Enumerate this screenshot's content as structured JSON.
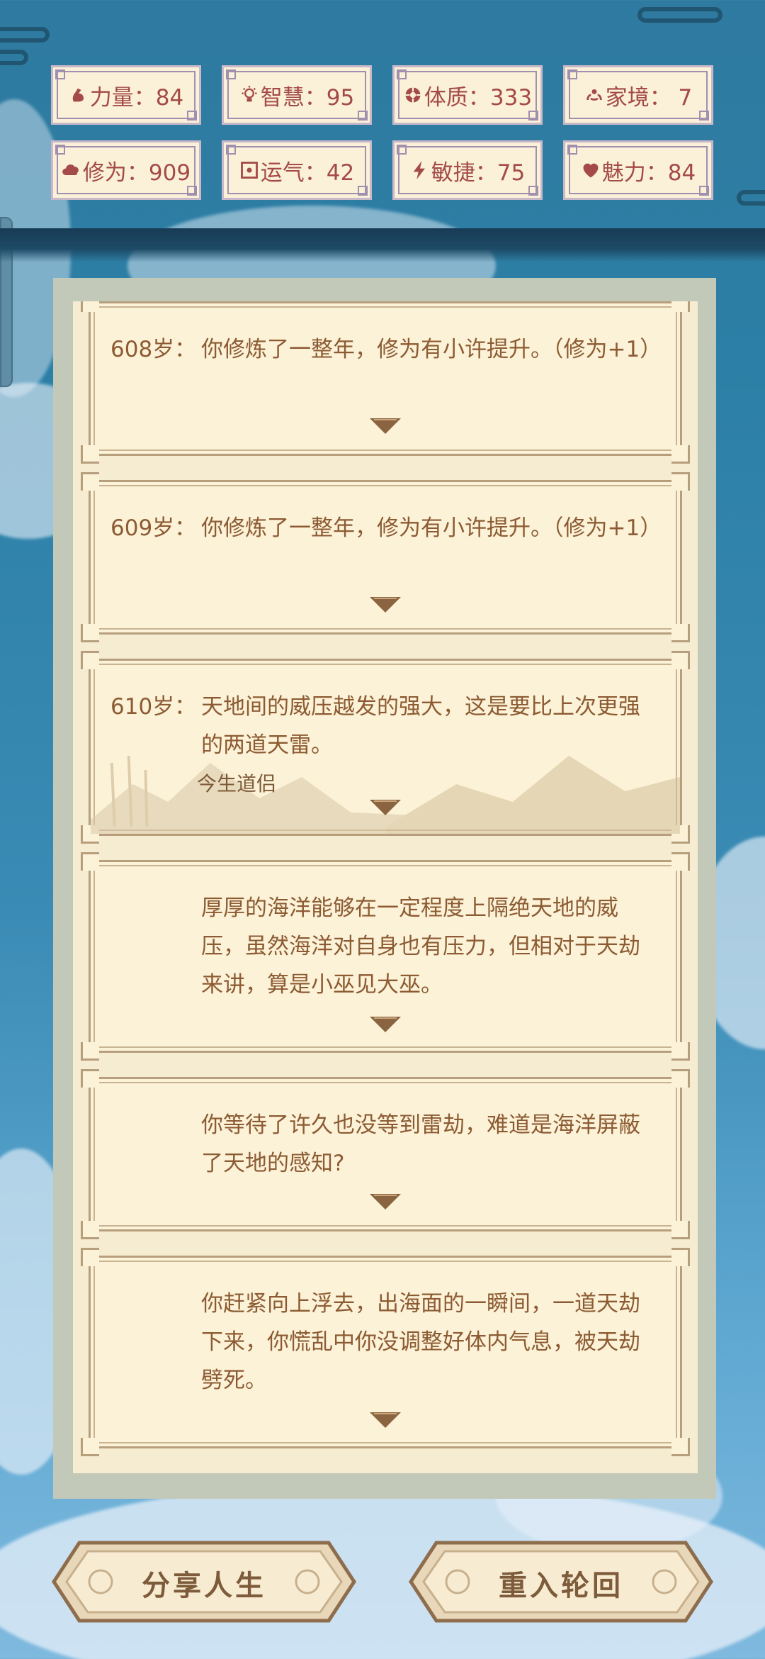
{
  "stats": [
    {
      "icon": "strength-arm-icon",
      "text": "力量：84"
    },
    {
      "icon": "lightbulb-icon",
      "text": "智慧：95"
    },
    {
      "icon": "constitution-icon",
      "text": "体质：333"
    },
    {
      "icon": "family-icon",
      "text": "家境： 7"
    },
    {
      "icon": "cloud-cultivation-icon",
      "text": "修为：909"
    },
    {
      "icon": "luck-box-icon",
      "text": "运气：42"
    },
    {
      "icon": "lightning-icon",
      "text": "敏捷：75"
    },
    {
      "icon": "heart-icon",
      "text": "魅力：84"
    }
  ],
  "events": [
    {
      "age": "608岁：",
      "text": "你修炼了一整年，修为有小许提升。（修为+1）"
    },
    {
      "age": "609岁：",
      "text": "你修炼了一整年，修为有小许提升。（修为+1）"
    },
    {
      "age": "610岁：",
      "text": "天地间的威压越发的强大，这是要比上次更强的两道天雷。",
      "tag": "今生道侣"
    },
    {
      "age": "",
      "text": "厚厚的海洋能够在一定程度上隔绝天地的威压，虽然海洋对自身也有压力，但相对于天劫来讲，算是小巫见大巫。"
    },
    {
      "age": "",
      "text": "你等待了许久也没等到雷劫，难道是海洋屏蔽了天地的感知?"
    },
    {
      "age": "",
      "text": "你赶紧向上浮去，出海面的一瞬间，一道天劫下来，你慌乱中你没调整好体内气息，被天劫劈死。"
    }
  ],
  "buttons": {
    "share": "分享人生",
    "restart": "重入轮回"
  },
  "colors": {
    "stat_text": "#a44a48",
    "event_text": "#8c5b33",
    "card_bg": "#fcf2d7",
    "button_text": "#7d5b3b"
  }
}
